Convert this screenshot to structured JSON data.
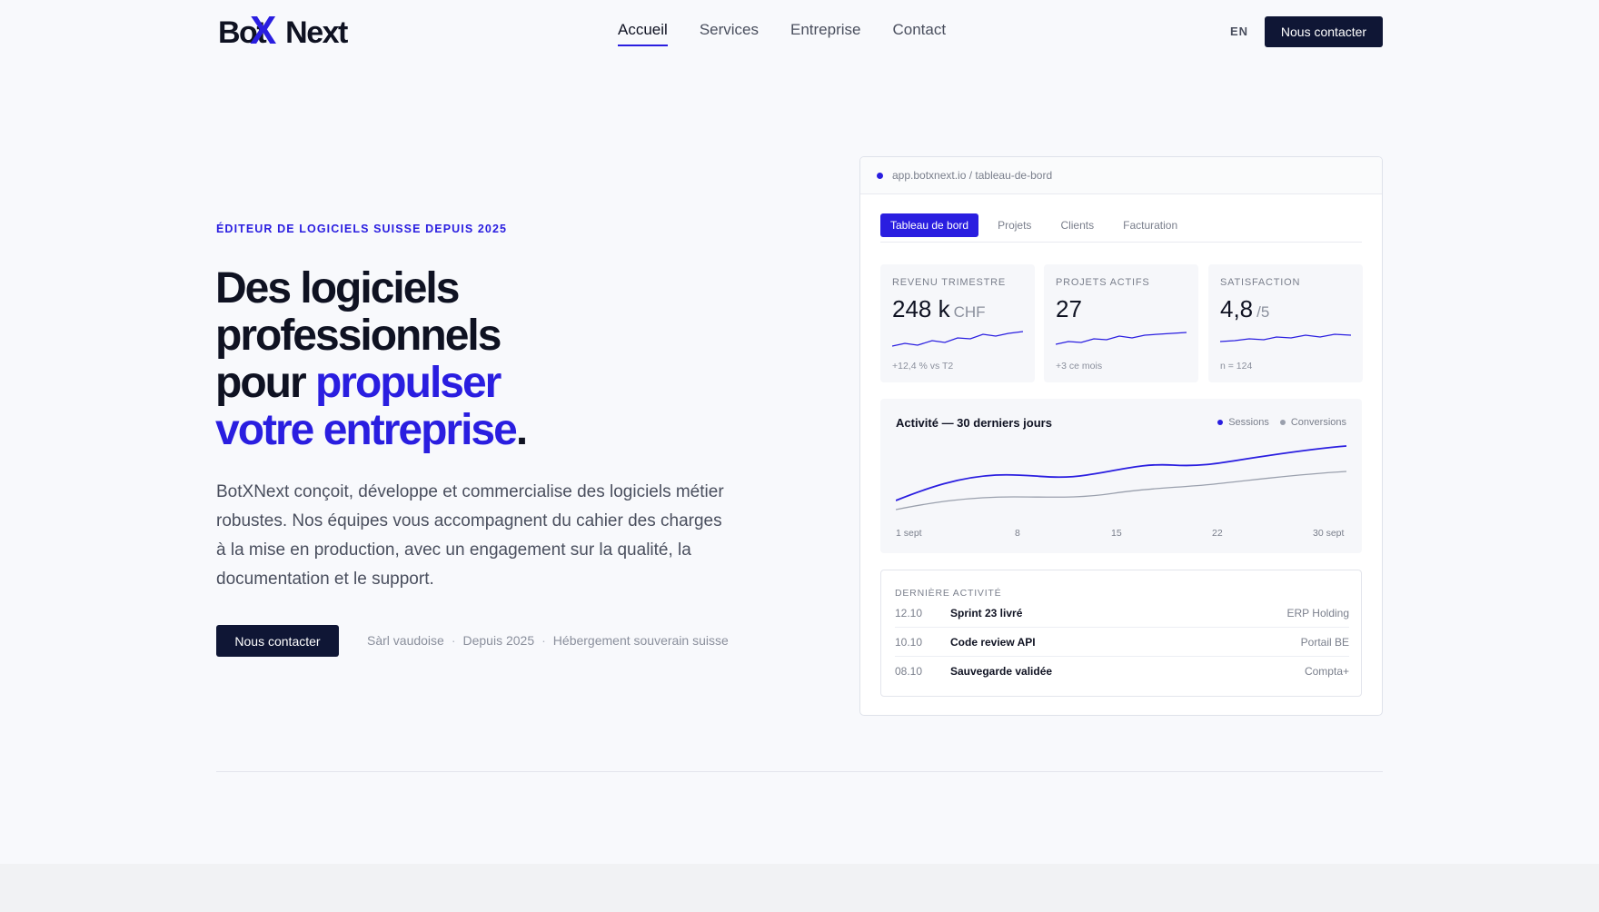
{
  "brand": {
    "logo_left": "Bot",
    "logo_x": "X",
    "logo_right": "Next"
  },
  "nav": {
    "items": [
      {
        "label": "Accueil",
        "active": true
      },
      {
        "label": "Services"
      },
      {
        "label": "Entreprise"
      },
      {
        "label": "Contact"
      }
    ],
    "lang": "EN",
    "cta": "Nous contacter"
  },
  "hero": {
    "eyebrow": "ÉDITEUR DE LOGICIELS SUISSE DEPUIS 2025",
    "title_line1": "Des logiciels",
    "title_line2": "professionnels",
    "title_line3_a": "pour ",
    "title_line3_b": "propulser",
    "title_line4": "votre entreprise",
    "title_period": ".",
    "description": "BotXNext conçoit, développe et commercialise des logiciels métier robustes. Nos équipes vous accompagnent du cahier des charges à la mise en production, avec un engagement sur la qualité, la documentation et le support.",
    "cta": "Nous contacter",
    "meta": [
      "Sàrl vaudoise",
      "Depuis 2025",
      "Hébergement souverain suisse"
    ],
    "meta_sep": "·"
  },
  "dashboard": {
    "url": "app.botxnext.io / tableau-de-bord",
    "tabs": [
      {
        "label": "Tableau de bord",
        "active": true
      },
      {
        "label": "Projets"
      },
      {
        "label": "Clients"
      },
      {
        "label": "Facturation"
      }
    ],
    "kpis": [
      {
        "label": "REVENU TRIMESTRE",
        "value": "248 k",
        "unit": "CHF",
        "foot": "+12,4 % vs T2"
      },
      {
        "label": "PROJETS ACTIFS",
        "value": "27",
        "unit": "",
        "foot": "+3 ce mois"
      },
      {
        "label": "SATISFACTION",
        "value": "4,8",
        "unit": "/5",
        "foot": "n = 124"
      }
    ],
    "activity": {
      "title": "Activité — 30 derniers jours",
      "legend": [
        "Sessions",
        "Conversions"
      ],
      "x_ticks": [
        "1 sept",
        "8",
        "15",
        "22",
        "30 sept"
      ]
    },
    "recent": {
      "label": "DERNIÈRE ACTIVITÉ",
      "rows": [
        {
          "date": "12.10",
          "name": "Sprint 23 livré",
          "client": "ERP Holding"
        },
        {
          "date": "10.10",
          "name": "Code review API",
          "client": "Portail BE"
        },
        {
          "date": "08.10",
          "name": "Sauvegarde validée",
          "client": "Compta+"
        }
      ]
    }
  },
  "colors": {
    "accent": "#2a1ee0",
    "dark": "#0f1635",
    "muted": "#9aa0ad"
  }
}
